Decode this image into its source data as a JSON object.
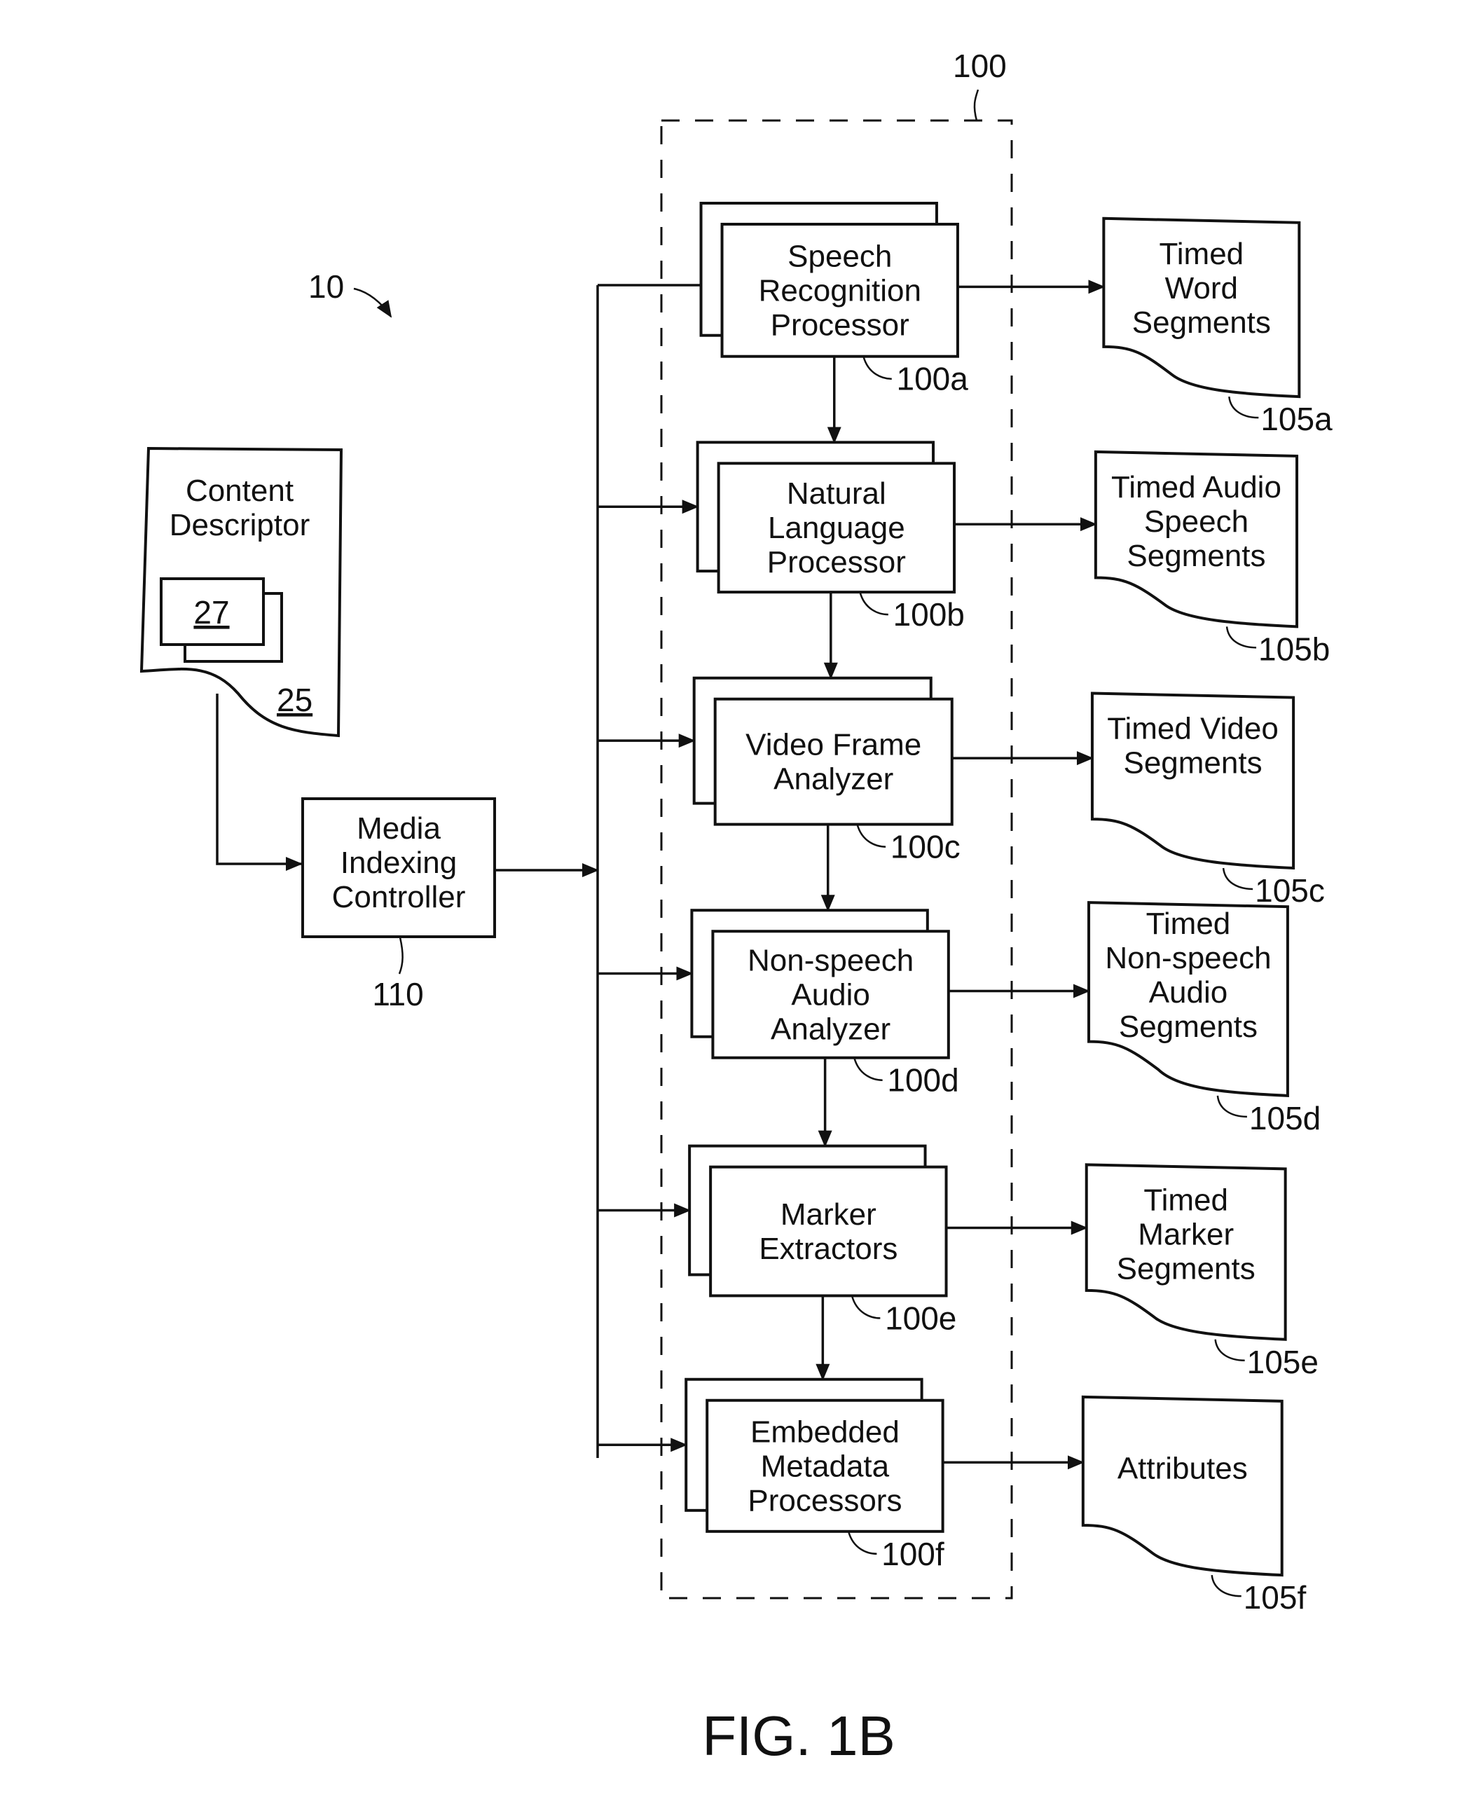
{
  "figure": {
    "caption": "FIG. 1B",
    "system_ref": "10",
    "module_group_ref": "100"
  },
  "content_descriptor": {
    "label_lines": [
      "Content",
      "Descriptor"
    ],
    "ref": "25",
    "inner_item_ref": "27"
  },
  "controller": {
    "label_lines": [
      "Media",
      "Indexing",
      "Controller"
    ],
    "ref": "110"
  },
  "processors": [
    {
      "label_lines": [
        "Speech",
        "Recognition",
        "Processor"
      ],
      "ref": "100a"
    },
    {
      "label_lines": [
        "Natural",
        "Language",
        "Processor"
      ],
      "ref": "100b"
    },
    {
      "label_lines": [
        "Video Frame",
        "Analyzer"
      ],
      "ref": "100c"
    },
    {
      "label_lines": [
        "Non-speech",
        "Audio",
        "Analyzer"
      ],
      "ref": "100d"
    },
    {
      "label_lines": [
        "Marker",
        "Extractors"
      ],
      "ref": "100e"
    },
    {
      "label_lines": [
        "Embedded",
        "Metadata",
        "Processors"
      ],
      "ref": "100f"
    }
  ],
  "outputs": [
    {
      "label_lines": [
        "Timed",
        "Word",
        "Segments"
      ],
      "ref": "105a"
    },
    {
      "label_lines": [
        "Timed Audio",
        "Speech",
        "Segments"
      ],
      "ref": "105b"
    },
    {
      "label_lines": [
        "Timed Video",
        "Segments"
      ],
      "ref": "105c"
    },
    {
      "label_lines": [
        "Timed",
        "Non-speech",
        "Audio",
        "Segments"
      ],
      "ref": "105d"
    },
    {
      "label_lines": [
        "Timed",
        "Marker",
        "Segments"
      ],
      "ref": "105e"
    },
    {
      "label_lines": [
        "Attributes"
      ],
      "ref": "105f"
    }
  ]
}
